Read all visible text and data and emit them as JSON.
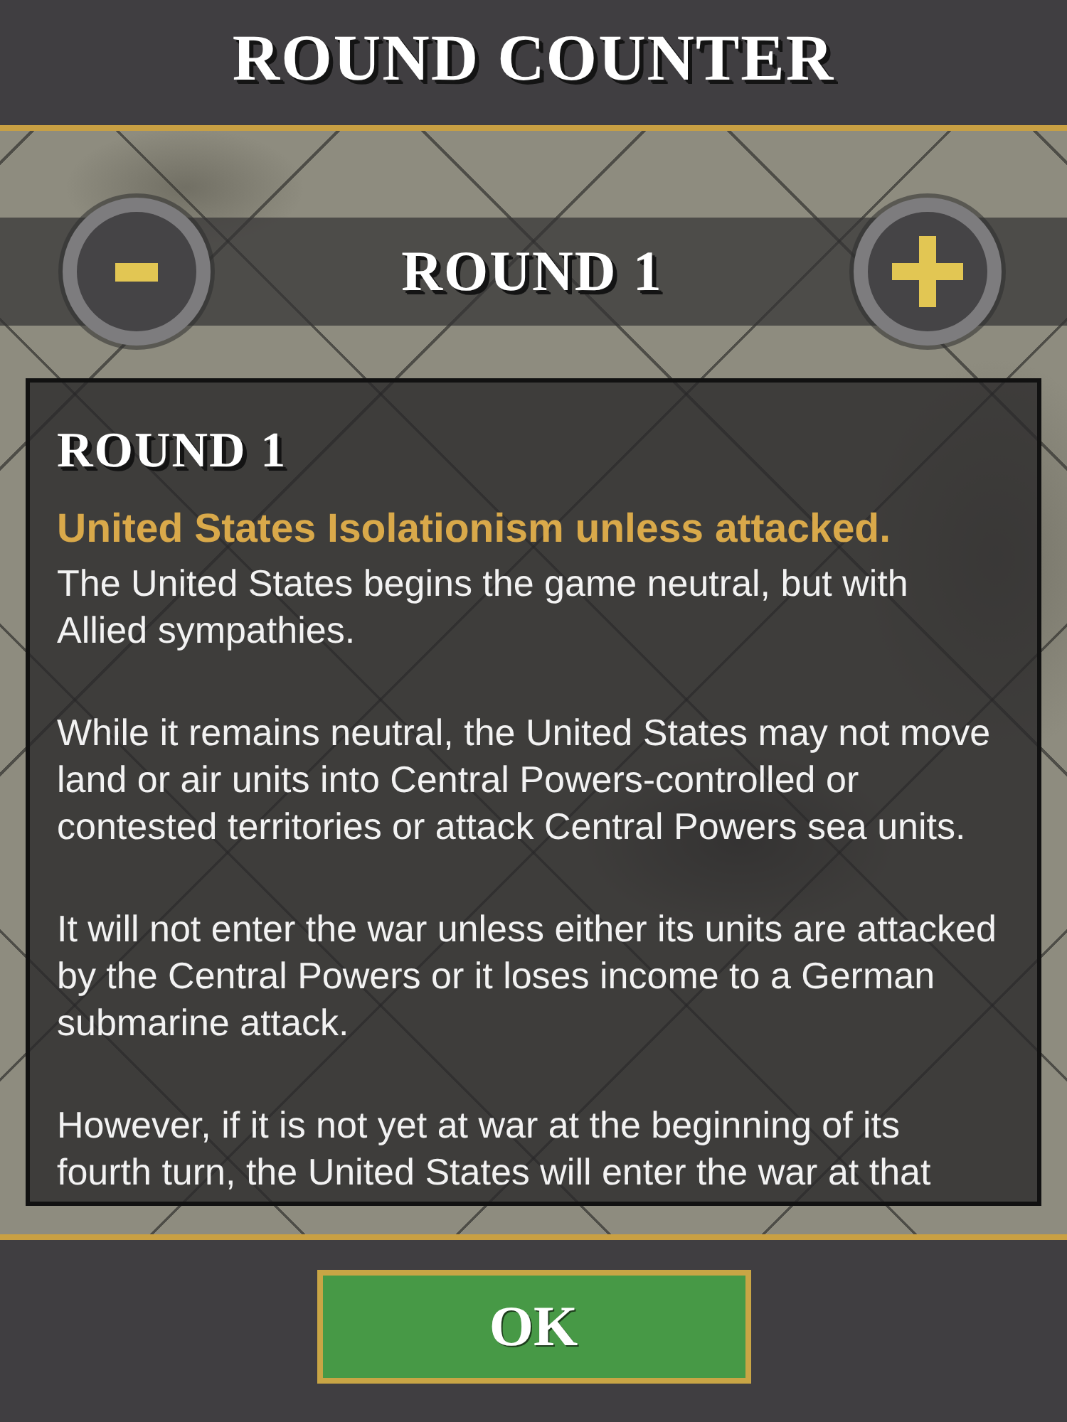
{
  "header": {
    "title": "ROUND COUNTER"
  },
  "counter": {
    "label": "ROUND 1"
  },
  "panel": {
    "heading": "ROUND 1",
    "subtitle": "United States Isolationism unless attacked.",
    "paragraphs": [
      "The United States begins the game neutral, but with Allied sympathies.",
      "While it remains neutral, the United States may not move land or air units into Central Powers-controlled or contested territories or attack Central Powers sea units.",
      "It will not enter the war unless either its units are attacked by the Central Powers or it loses income to a German submarine attack.",
      "However, if it is not yet at war at the beginning of its fourth turn, the United States will enter the war at that"
    ]
  },
  "footer": {
    "button": "OK"
  }
}
